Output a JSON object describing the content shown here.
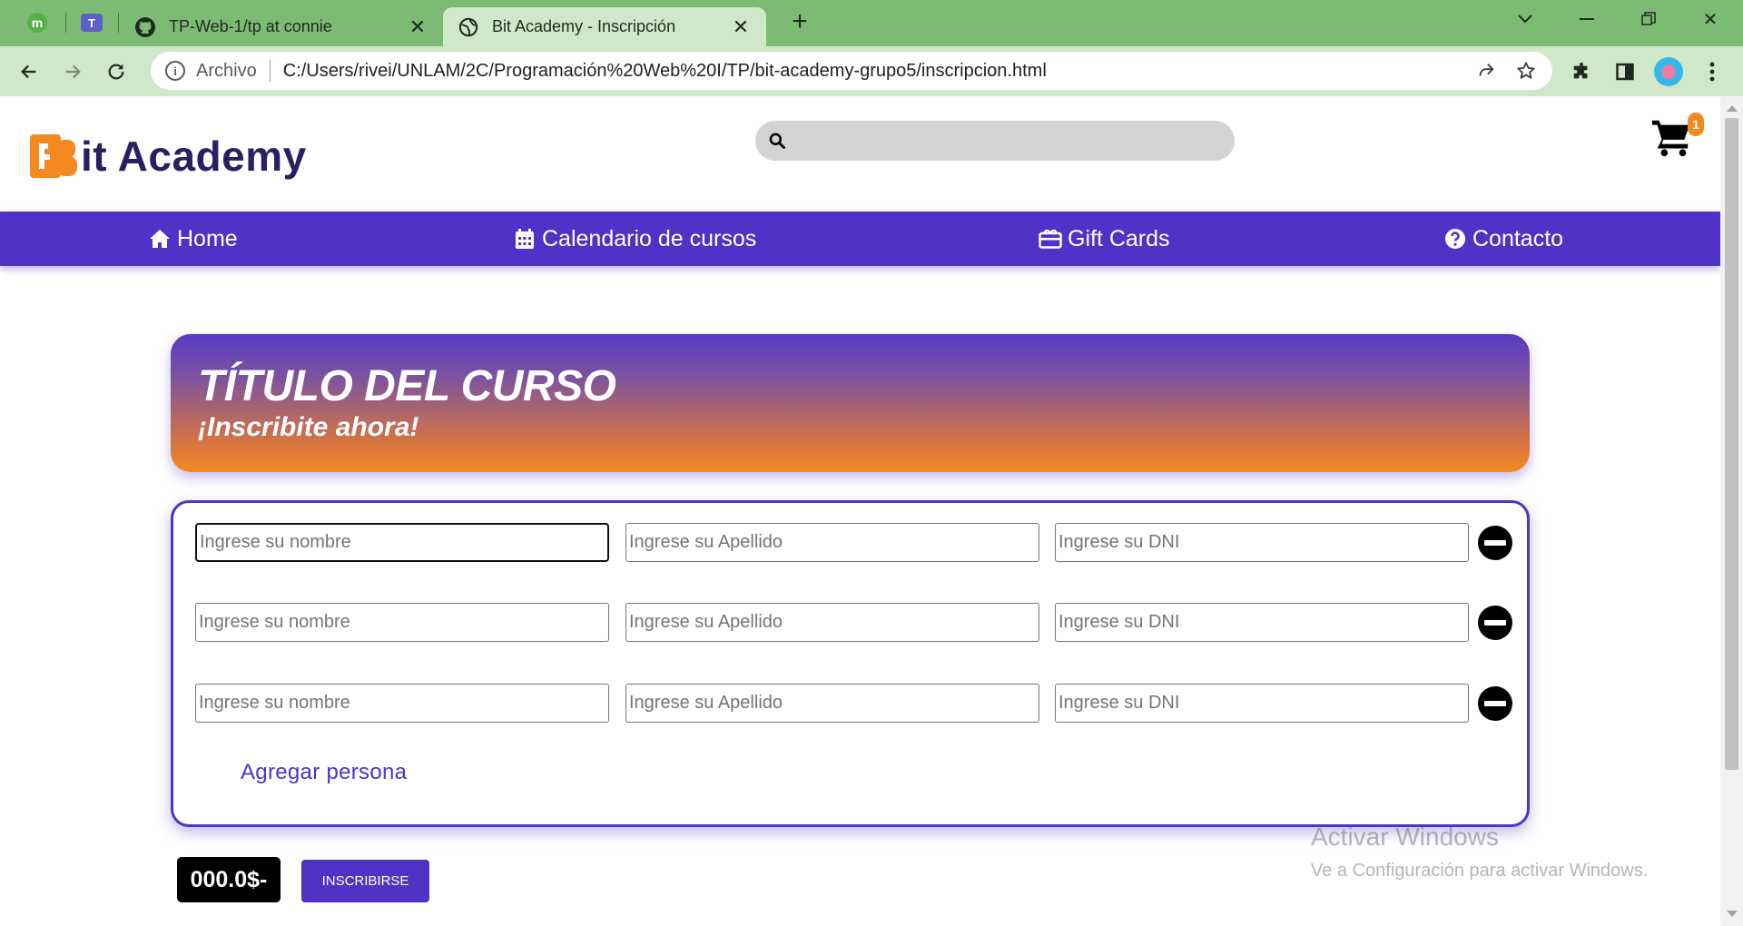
{
  "browser": {
    "tabs": [
      {
        "title": "TP-Web-1/tp at connie",
        "icon": "github-icon"
      },
      {
        "title": "Bit Academy - Inscripción",
        "icon": "globe-icon",
        "active": true
      }
    ],
    "pinned": [
      "m",
      "teams"
    ],
    "address": {
      "security_label": "Archivo",
      "url": "C:/Users/rivei/UNLAM/2C/Programación%20Web%20I/TP/bit-academy-grupo5/inscripcion.html"
    }
  },
  "header": {
    "logo_text": "it Academy",
    "logo_letter": "B",
    "search": {
      "placeholder": "",
      "value": ""
    },
    "cart": {
      "count": "1"
    }
  },
  "nav": {
    "items": [
      {
        "label": "Home",
        "icon": "home-icon"
      },
      {
        "label": "Calendario de cursos",
        "icon": "calendar-icon"
      },
      {
        "label": "Gift Cards",
        "icon": "gift-icon"
      },
      {
        "label": "Contacto",
        "icon": "question-circle-icon"
      }
    ]
  },
  "course": {
    "title": "TÍTULO DEL CURSO",
    "subtitle": "¡Inscribite ahora!"
  },
  "form": {
    "rows": [
      {
        "nombre_placeholder": "Ingrese su nombre",
        "apellido_placeholder": "Ingrese su Apellido",
        "dni_placeholder": "Ingrese su DNI"
      },
      {
        "nombre_placeholder": "Ingrese su nombre",
        "apellido_placeholder": "Ingrese su Apellido",
        "dni_placeholder": "Ingrese su DNI"
      },
      {
        "nombre_placeholder": "Ingrese su nombre",
        "apellido_placeholder": "Ingrese su Apellido",
        "dni_placeholder": "Ingrese su DNI"
      }
    ],
    "add_person_label": "Agregar persona"
  },
  "footer": {
    "price": "000.0$-",
    "submit_label": "INSCRIBIRSE"
  },
  "watermark": {
    "line1": "Activar Windows",
    "line2": "Ve a Configuración para activar Windows."
  },
  "colors": {
    "brand_purple": "#5033c6",
    "brand_orange": "#f48a1f",
    "logo_navy": "#2b1f63",
    "chrome_green": "#7cbb74"
  }
}
